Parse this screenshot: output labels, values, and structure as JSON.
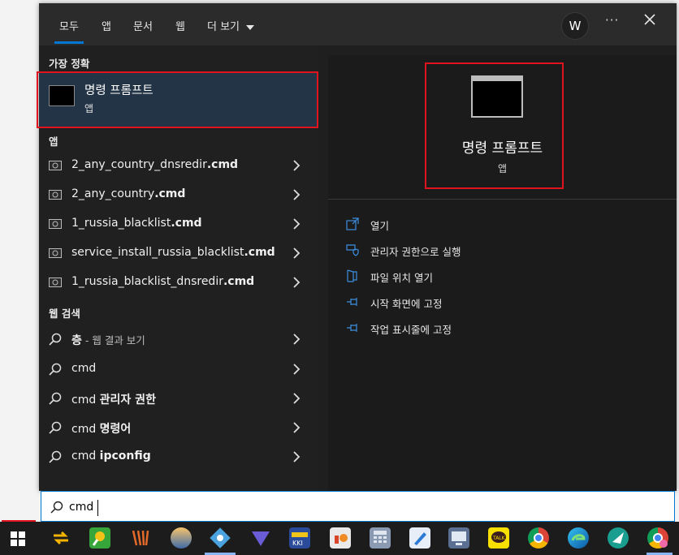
{
  "tabs": [
    {
      "label": "모두"
    },
    {
      "label": "앱"
    },
    {
      "label": "문서"
    },
    {
      "label": "웹"
    },
    {
      "label": "더 보기"
    }
  ],
  "account": {
    "initial": "W"
  },
  "best_match": {
    "section": "가장 정확",
    "title": "명령 프롬프트",
    "subtitle": "앱"
  },
  "apps": {
    "section": "앱",
    "items": [
      {
        "name": "2_any_country_dnsredir",
        "ext": ".cmd"
      },
      {
        "name": "2_any_country",
        "ext": ".cmd"
      },
      {
        "name": "1_russia_blacklist",
        "ext": ".cmd"
      },
      {
        "name": "service_install_russia_blacklist",
        "ext": ".cmd"
      },
      {
        "name": "1_russia_blacklist_dnsredir",
        "ext": ".cmd"
      }
    ]
  },
  "web": {
    "section": "웹 검색",
    "items": [
      {
        "main": "층",
        "sub": " - 웹 결과 보기"
      },
      {
        "main": "cmd",
        "bold": ""
      },
      {
        "main": "cmd ",
        "bold": "관리자 권한"
      },
      {
        "main": "cmd ",
        "bold": "명령어"
      },
      {
        "main": "cmd ",
        "bold": "ipconfig"
      }
    ]
  },
  "preview": {
    "title": "명령 프롬프트",
    "subtitle": "앱",
    "actions": [
      {
        "label": "열기",
        "icon": "open-icon"
      },
      {
        "label": "관리자 권한으로 실행",
        "icon": "shield-icon"
      },
      {
        "label": "파일 위치 열기",
        "icon": "folder-icon"
      },
      {
        "label": "시작 화면에 고정",
        "icon": "pin-icon"
      },
      {
        "label": "작업 표시줄에 고정",
        "icon": "pin-icon"
      }
    ]
  },
  "search": {
    "value": "cmd"
  },
  "colors": {
    "accent": "#0078d4",
    "highlight": "#e0141e",
    "selected_bg": "#233447"
  }
}
